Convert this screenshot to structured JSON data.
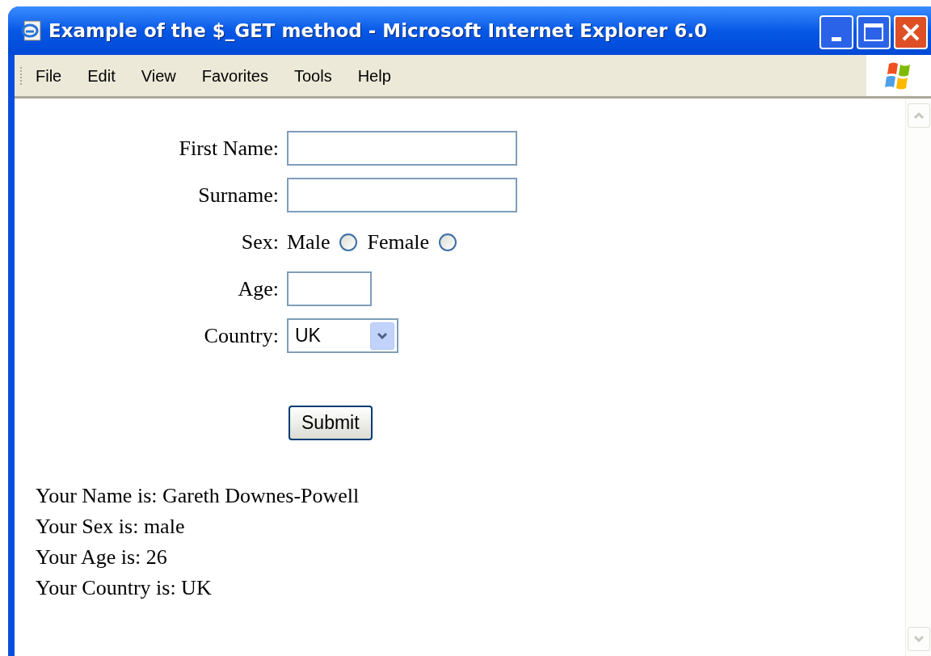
{
  "window": {
    "title": "Example of the $_GET method - Microsoft Internet Explorer 6.0"
  },
  "menu": [
    "File",
    "Edit",
    "View",
    "Favorites",
    "Tools",
    "Help"
  ],
  "form": {
    "fields": [
      {
        "kind": "text",
        "label": "First Name:"
      },
      {
        "kind": "text",
        "label": "Surname:"
      },
      {
        "kind": "radio",
        "label": "Sex:",
        "options": [
          {
            "label": "Male",
            "selected": false
          },
          {
            "label": "Female",
            "selected": false
          }
        ]
      },
      {
        "kind": "short_text",
        "label": "Age:"
      },
      {
        "kind": "select",
        "label": "Country:",
        "value": "UK"
      }
    ],
    "submit": "Submit"
  },
  "results": [
    "Your Name is: Gareth Downes-Powell",
    "Your Sex is: male",
    "Your Age is: 26",
    "Your Country is: UK"
  ]
}
